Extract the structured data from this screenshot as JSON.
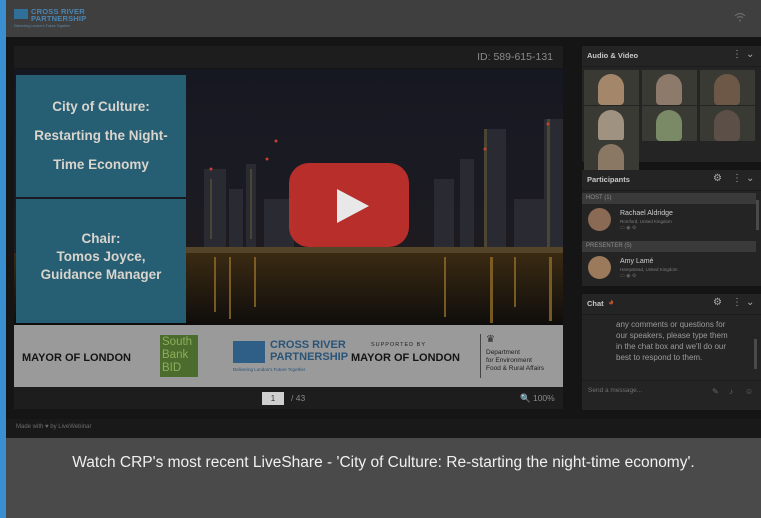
{
  "app": {
    "logo_line1": "CROSS RIVER",
    "logo_line2": "PARTNERSHIP",
    "logo_tagline": "Delivering London's Future Together",
    "wifi_icon": "wifi-icon"
  },
  "presentation": {
    "id_label": "ID: 589-615-131",
    "slide": {
      "title_lines": [
        "City of Culture:",
        "Restarting the Night-",
        "Time Economy"
      ],
      "chair_lines": [
        "Chair:",
        "Tomos Joyce,",
        "Guidance Manager"
      ],
      "footer": {
        "mayor": "MAYOR OF LONDON",
        "south_bank_bid": [
          "South",
          "Bank",
          "BID"
        ],
        "crp_line1": "CROSS RIVER",
        "crp_line2": "PARTNERSHIP",
        "crp_tagline": "Delivering London's Future Together",
        "supported_by": "SUPPORTED BY",
        "mayor2": "MAYOR OF LONDON",
        "defra_lines": [
          "Department",
          "for Environment",
          "Food & Rural Affairs"
        ]
      }
    },
    "page_current": "1",
    "page_total": "/ 43",
    "zoom": "100%",
    "zoom_icon": "zoom-icon"
  },
  "footer": {
    "made_with": "Made with ♥ by LiveWebinar"
  },
  "caption": "Watch CRP's most recent LiveShare - 'City of Culture: Re-starting the night-time economy'.",
  "panels": {
    "audio_video": {
      "title": "Audio & Video",
      "participant_colors": [
        "#a4876a",
        "#8d7a6b",
        "#6d5848",
        "#a09280",
        "#7a8a66",
        "#5c4f48",
        "#8a7764"
      ]
    },
    "participants": {
      "title": "Participants",
      "host_header": "HOST (1)",
      "host": {
        "name": "Rachael Aldridge",
        "location": "Romford, United Kingdom"
      },
      "presenter_header": "PRESENTER (5)",
      "presenter": {
        "name": "Amy Lamé",
        "location": "Hampstead, United Kingdom"
      }
    },
    "chat": {
      "title": "Chat",
      "message": "any comments or questions for our speakers, please type them in the chat box and we'll do our best to respond to them.",
      "placeholder": "Send a message..."
    }
  },
  "colors": {
    "accent_left": "#3a8fd1",
    "youtube_red": "#c4302b",
    "slide_teal": "#265e74"
  }
}
